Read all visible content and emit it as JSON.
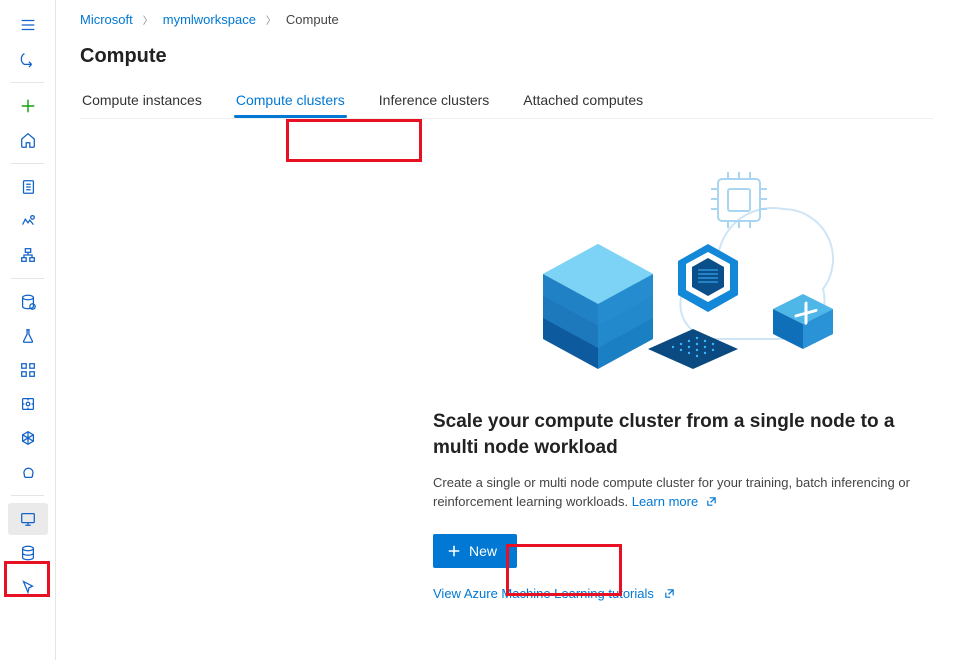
{
  "breadcrumb": {
    "root": "Microsoft",
    "workspace": "mymlworkspace",
    "current": "Compute"
  },
  "page": {
    "title": "Compute"
  },
  "tabs": {
    "instances": "Compute instances",
    "clusters": "Compute clusters",
    "inference": "Inference clusters",
    "attached": "Attached computes"
  },
  "hero": {
    "title": "Scale your compute cluster from a single node to a multi node workload",
    "desc": "Create a single or multi node compute cluster for your training, batch inferencing or reinforcement learning workloads. ",
    "learn_more": "Learn more",
    "new_button": "New",
    "tutorials": "View Azure Machine Learning tutorials"
  },
  "sidebar": {
    "items": [
      "menu",
      "back",
      "add",
      "home",
      "notebooks",
      "automl",
      "designer",
      "datasets",
      "experiments",
      "pipelines",
      "models",
      "endpoints",
      "environments",
      "compute",
      "datastores",
      "data-labeling"
    ]
  }
}
